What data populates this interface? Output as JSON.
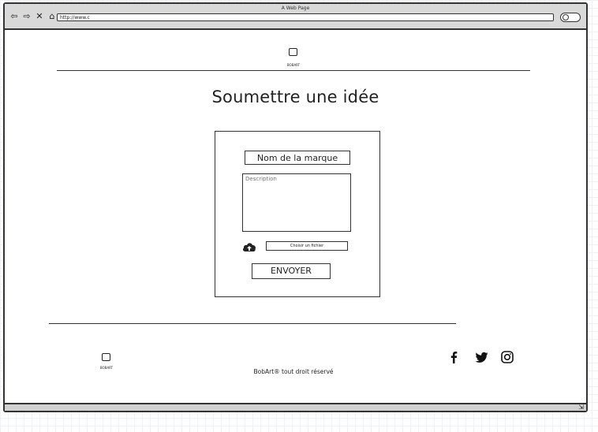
{
  "browser": {
    "window_title": "A Web Page",
    "url": "http://www.c",
    "nav_icons": [
      "back-arrow-icon",
      "forward-arrow-icon",
      "close-icon",
      "home-icon"
    ]
  },
  "header": {
    "logo_text": "BOBART"
  },
  "main": {
    "title": "Soumettre une idée",
    "form": {
      "brand_field_value": "Nom de la marque",
      "description_placeholder": "Description",
      "upload_icon": "cloud-upload-icon",
      "file_button_label": "Choisir un fichier",
      "submit_label": "ENVOYER"
    }
  },
  "footer": {
    "logo_text": "BOBART",
    "copyright": "BobArt® tout droit réservé",
    "social_icons": [
      "facebook-icon",
      "twitter-icon",
      "instagram-icon"
    ]
  }
}
